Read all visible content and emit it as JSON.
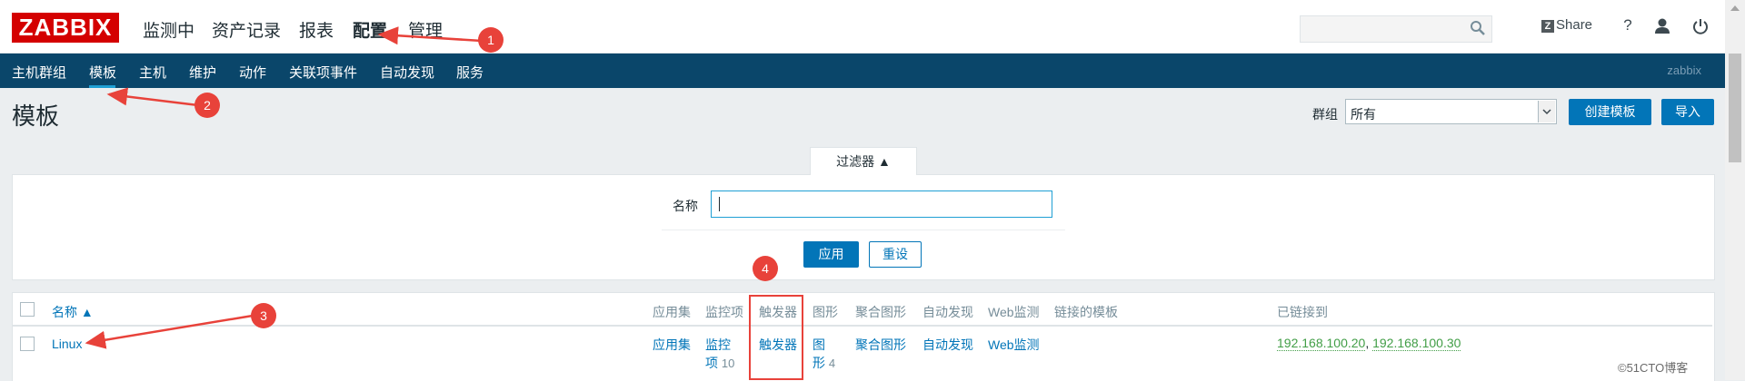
{
  "header": {
    "logo": "ZABBIX",
    "nav": [
      "监测中",
      "资产记录",
      "报表",
      "配置",
      "管理"
    ],
    "share": "Share",
    "help": "?"
  },
  "subnav": {
    "items": [
      "主机群组",
      "模板",
      "主机",
      "维护",
      "动作",
      "关联项事件",
      "自动发现",
      "服务"
    ],
    "server": "zabbix"
  },
  "page": {
    "title": "模板",
    "group_label": "群组",
    "group_value": "所有",
    "create_button": "创建模板",
    "import_button": "导入"
  },
  "filter": {
    "tab_label": "过滤器 ▲",
    "name_label": "名称",
    "name_value": "",
    "apply": "应用",
    "reset": "重设"
  },
  "table": {
    "headers": [
      "名称 ▲",
      "应用集",
      "监控项",
      "触发器",
      "图形",
      "聚合图形",
      "自动发现",
      "Web监测",
      "链接的模板",
      "已链接到"
    ],
    "rows": [
      {
        "name": "Linux",
        "applications": "应用集",
        "items_label_1": "监控",
        "items_label_2": "项",
        "items_count": "10",
        "triggers": "触发器",
        "graphs_label_1": "图",
        "graphs_label_2": "形",
        "graphs_count": "4",
        "screens": "聚合图形",
        "discovery": "自动发现",
        "web": "Web监测",
        "linked_to": [
          "192.168.100.20",
          "192.168.100.30"
        ]
      }
    ]
  },
  "annotations": [
    "1",
    "2",
    "3",
    "4"
  ],
  "watermark": "©51CTO博客",
  "colors": {
    "brand": "#d40000",
    "subnav": "#0a466a",
    "accent": "#0275b8",
    "annotation": "#e8423a",
    "linked_host": "#429e47"
  }
}
